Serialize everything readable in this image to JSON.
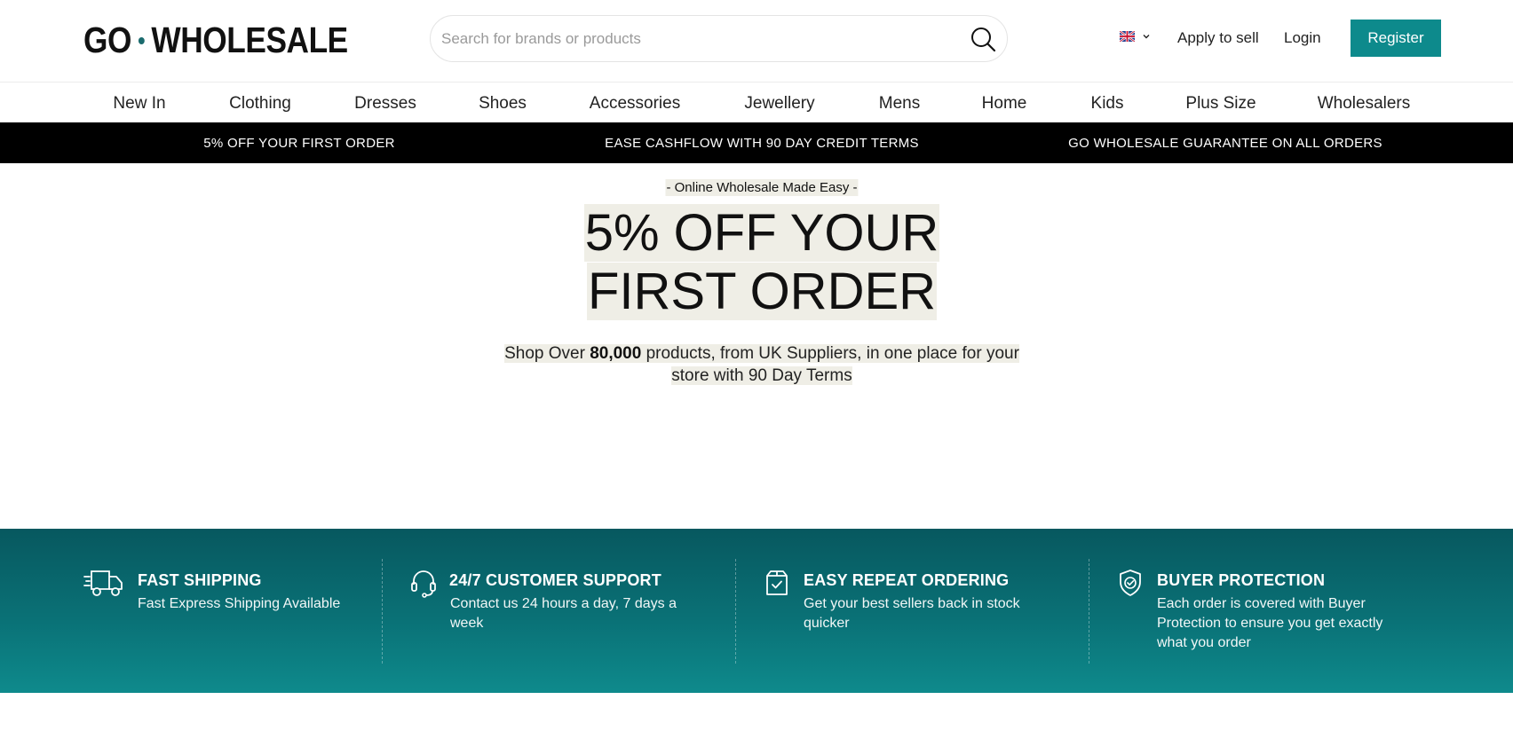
{
  "header": {
    "logo_left": "GO",
    "logo_right": "WHOLESALE",
    "search_placeholder": "Search for brands or products",
    "apply_label": "Apply to sell",
    "login_label": "Login",
    "register_label": "Register"
  },
  "nav": {
    "items": [
      "New In",
      "Clothing",
      "Dresses",
      "Shoes",
      "Accessories",
      "Jewellery",
      "Mens",
      "Home",
      "Kids",
      "Plus Size",
      "Wholesalers"
    ]
  },
  "promo_bar": {
    "items": [
      "5% OFF YOUR FIRST ORDER",
      "EASE CASHFLOW WITH 90 DAY CREDIT TERMS",
      "GO WHOLESALE GUARANTEE ON ALL ORDERS"
    ]
  },
  "hero": {
    "eyebrow": "- Online Wholesale Made Easy -",
    "title": "5% OFF YOUR FIRST ORDER",
    "subtitle_pre": "Shop Over ",
    "subtitle_bold": "80,000",
    "subtitle_post": " products, from UK Suppliers, in one place for your store with 90 Day Terms"
  },
  "features": [
    {
      "icon": "truck-icon",
      "title": "FAST SHIPPING",
      "desc": "Fast Express Shipping Available"
    },
    {
      "icon": "headset-icon",
      "title": "24/7 CUSTOMER SUPPORT",
      "desc": "Contact us 24 hours a day, 7 days a week"
    },
    {
      "icon": "reorder-box-icon",
      "title": "EASY REPEAT ORDERING",
      "desc": "Get your best sellers back in stock quicker"
    },
    {
      "icon": "shield-check-icon",
      "title": "BUYER PROTECTION",
      "desc": "Each order is covered with Buyer Protection to ensure you get exactly what you order"
    }
  ],
  "colors": {
    "brand_teal": "#0d8a8c",
    "promo_bar_bg": "#000000",
    "highlight": "#efeee6"
  }
}
